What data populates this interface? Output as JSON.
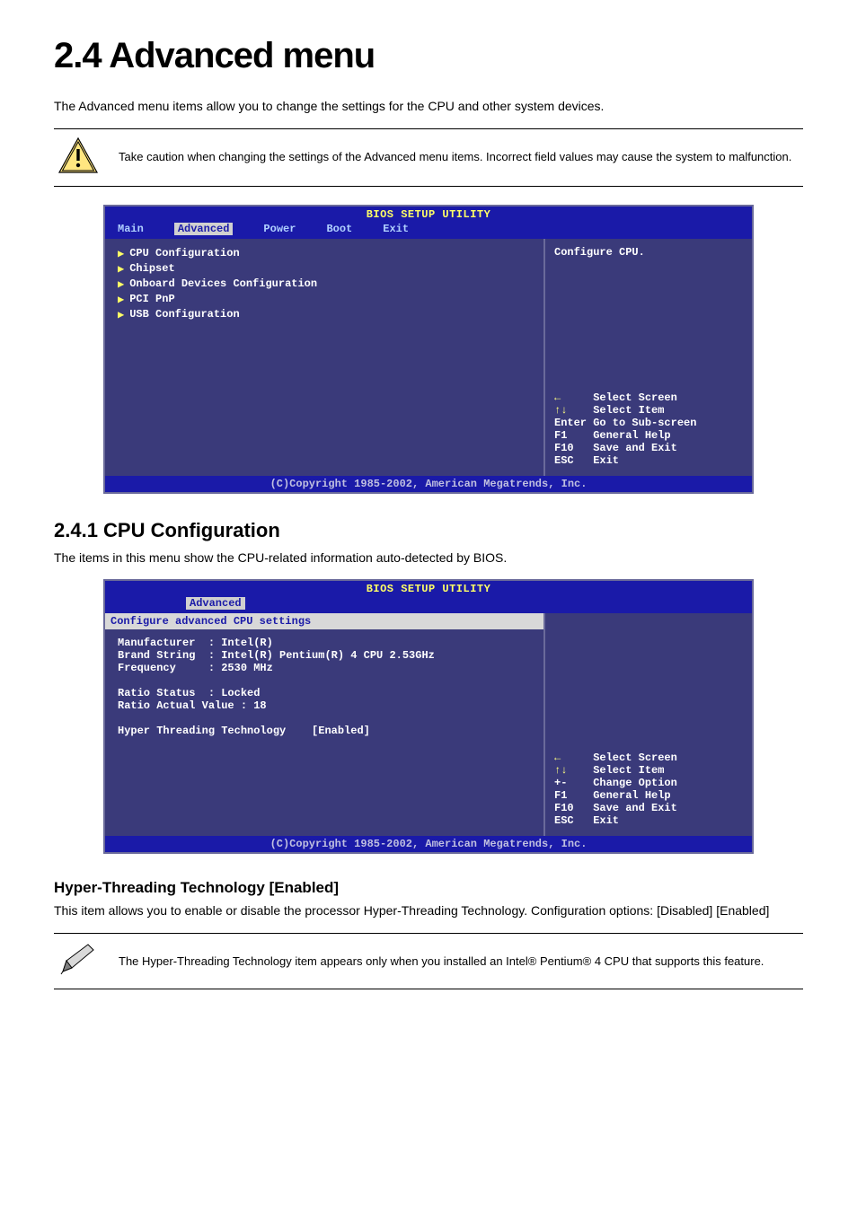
{
  "page": {
    "title": "2.4    Advanced menu",
    "intro": "The Advanced menu items allow you to change the settings for the CPU and other system devices."
  },
  "caution": "Take caution when changing the settings of the Advanced menu items. Incorrect field values may cause the system to malfunction.",
  "bios1": {
    "title": "BIOS SETUP UTILITY",
    "tabs": [
      "Main",
      "Advanced",
      "Power",
      "Boot",
      "Exit"
    ],
    "items": [
      "CPU Configuration",
      "Chipset",
      "Onboard Devices Configuration",
      "PCI PnP",
      "USB Configuration"
    ],
    "help_top": "Configure CPU.",
    "nav": {
      "l1": "      Select Screen",
      "l2": "      Select Item",
      "l3": "Enter Go to Sub-screen",
      "l4": "F1    General Help",
      "l5": "F10   Save and Exit",
      "l6": "ESC   Exit"
    },
    "footer": "(C)Copyright 1985-2002, American Megatrends, Inc."
  },
  "cpu_section": {
    "heading": "2.4.1 CPU Configuration",
    "text": "The items in this menu show the CPU-related information auto-detected by BIOS."
  },
  "bios2": {
    "title": "BIOS SETUP UTILITY",
    "tab": "Advanced",
    "header": "Configure advanced CPU settings",
    "lines": {
      "manu": "Manufacturer  : Intel(R)",
      "brand": "Brand String  : Intel(R) Pentium(R) 4 CPU 2.53GHz",
      "freq": "Frequency     : 2530 MHz",
      "blank1": " ",
      "ratio_s": "Ratio Status  : Locked",
      "ratio_v": "Ratio Actual Value : 18",
      "blank2": " ",
      "ht": "Hyper Threading Technology    [Enabled]"
    },
    "nav": {
      "l1": "      Select Screen",
      "l2": "      Select Item",
      "l3": "+-    Change Option",
      "l4": "F1    General Help",
      "l5": "F10   Save and Exit",
      "l6": "ESC   Exit"
    },
    "footer": "(C)Copyright 1985-2002, American Megatrends, Inc."
  },
  "ht_item": {
    "heading": "Hyper-Threading Technology [Enabled]",
    "text": "This item allows you to enable or disable the processor Hyper-Threading Technology. Configuration options: [Disabled] [Enabled]"
  },
  "note": "The Hyper-Threading Technology item appears only when you installed an Intel® Pentium® 4 CPU that supports this feature."
}
